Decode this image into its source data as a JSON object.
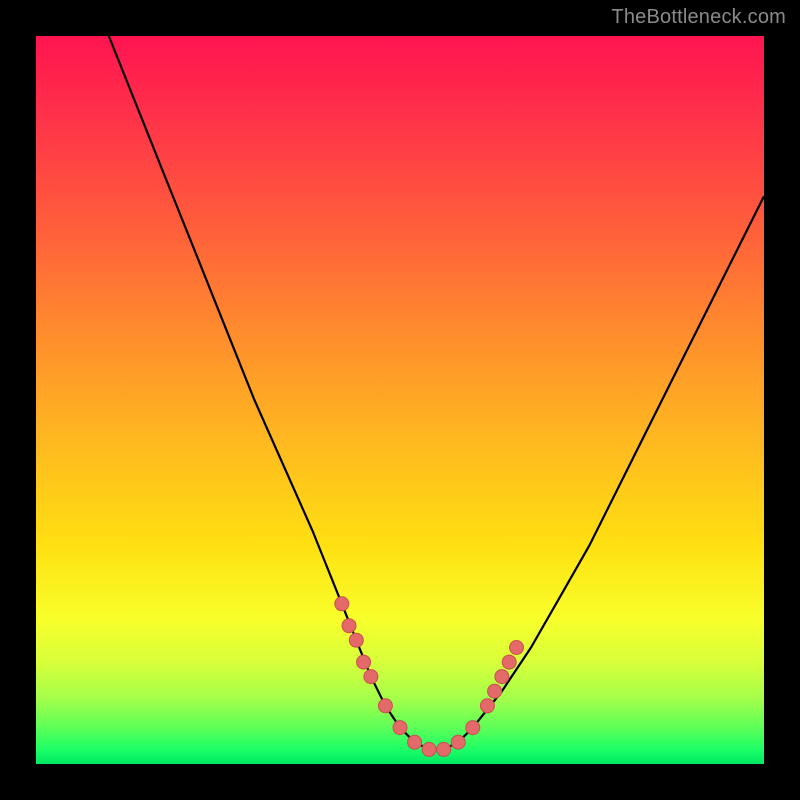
{
  "watermark": "TheBottleneck.com",
  "chart_data": {
    "type": "line",
    "title": "",
    "xlabel": "",
    "ylabel": "",
    "xlim": [
      0,
      100
    ],
    "ylim": [
      0,
      100
    ],
    "grid": false,
    "series": [
      {
        "name": "curve",
        "x": [
          10,
          14,
          18,
          22,
          26,
          30,
          34,
          38,
          42,
          44,
          46,
          48,
          50,
          52,
          54,
          56,
          58,
          60,
          64,
          68,
          72,
          76,
          80,
          84,
          88,
          92,
          96,
          100
        ],
        "y": [
          100,
          90,
          80,
          70,
          60,
          50,
          41,
          32,
          22,
          17,
          12,
          8,
          5,
          3,
          2,
          2,
          3,
          5,
          10,
          16,
          23,
          30,
          38,
          46,
          54,
          62,
          70,
          78
        ]
      }
    ],
    "points": {
      "name": "dots",
      "x": [
        42,
        43,
        44,
        45,
        46,
        48,
        50,
        52,
        54,
        56,
        58,
        60,
        62,
        63,
        64,
        65,
        66
      ],
      "y": [
        22,
        19,
        17,
        14,
        12,
        8,
        5,
        3,
        2,
        2,
        3,
        5,
        8,
        10,
        12,
        14,
        16
      ]
    }
  }
}
